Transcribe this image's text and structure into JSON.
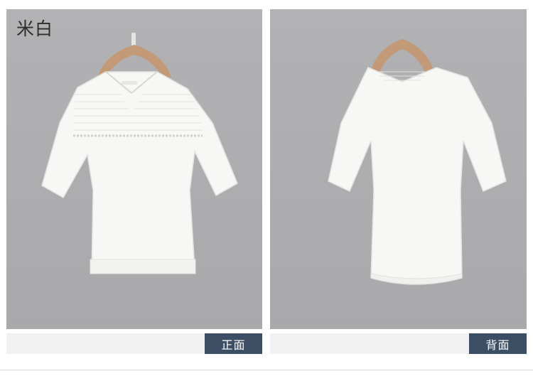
{
  "front": {
    "color_label": "米白",
    "view_label": "正面"
  },
  "back": {
    "view_label": "背面"
  },
  "colors": {
    "panel_bg": "#ababad",
    "view_tag_bg": "#3b4e64",
    "footer_bar_bg": "#f1f1f2",
    "garment": "#f7f7f5",
    "hanger": "#c29a78"
  }
}
